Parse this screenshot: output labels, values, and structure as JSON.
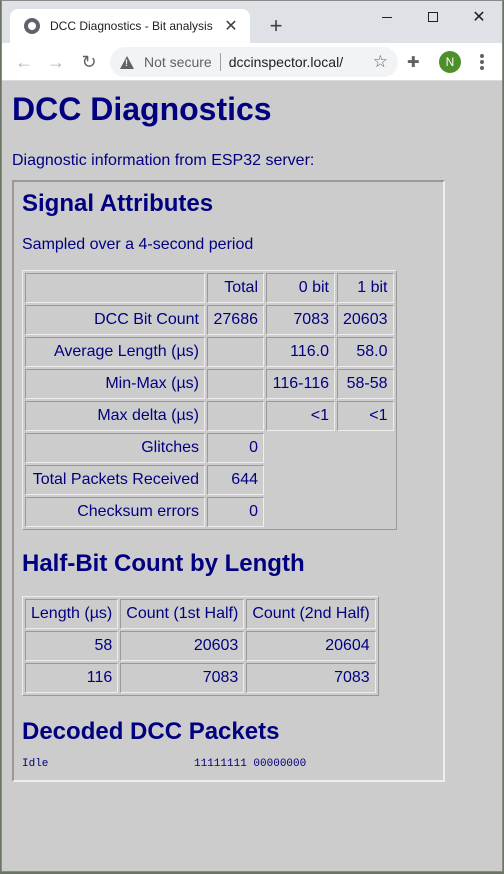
{
  "browser": {
    "tab_title": "DCC Diagnostics - Bit analysis",
    "security_label": "Not secure",
    "url": "dccinspector.local/",
    "profile_initial": "N"
  },
  "page": {
    "title": "DCC Diagnostics",
    "intro": "Diagnostic information from ESP32 server:",
    "signal": {
      "heading": "Signal Attributes",
      "subtitle": "Sampled over a 4-second period",
      "col_total": "Total",
      "col_zero": "0 bit",
      "col_one": "1 bit",
      "rows": [
        {
          "label": "DCC Bit Count",
          "total": "27686",
          "zero": "7083",
          "one": "20603"
        },
        {
          "label": "Average Length (µs)",
          "total": "",
          "zero": "116.0",
          "one": "58.0"
        },
        {
          "label": "Min-Max (µs)",
          "total": "",
          "zero": "116-116",
          "one": "58-58"
        },
        {
          "label": "Max delta (µs)",
          "total": "",
          "zero": "<1",
          "one": "<1"
        },
        {
          "label": "Glitches",
          "total": "0"
        },
        {
          "label": "Total Packets Received",
          "total": "644"
        },
        {
          "label": "Checksum errors",
          "total": "0"
        }
      ]
    },
    "halfbit": {
      "heading": "Half-Bit Count by Length",
      "col_length": "Length (µs)",
      "col_first": "Count (1st Half)",
      "col_second": "Count (2nd Half)",
      "rows": [
        {
          "length": "58",
          "first": "20603",
          "second": "20604"
        },
        {
          "length": "116",
          "first": "7083",
          "second": "7083"
        }
      ]
    },
    "packets": {
      "heading": "Decoded DCC Packets",
      "items": [
        {
          "name": "Idle",
          "bits": "11111111 00000000"
        }
      ]
    }
  }
}
